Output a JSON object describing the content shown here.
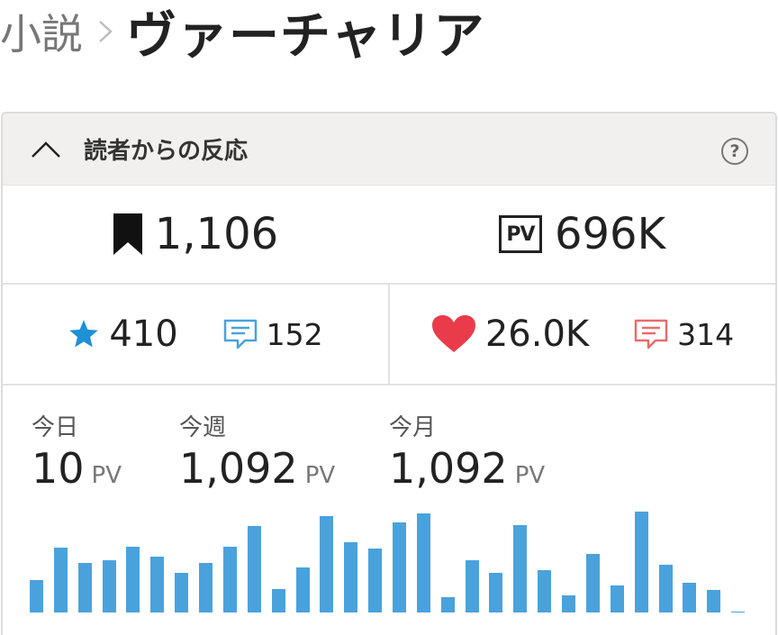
{
  "breadcrumb": {
    "parent": "小説",
    "title": "ヴァーチャリア"
  },
  "panel": {
    "title": "読者からの反応",
    "help": "?"
  },
  "bookmarks": {
    "icon": "bookmark-icon",
    "value": "1,106"
  },
  "pageviews": {
    "icon": "pv-icon",
    "icon_text": "PV",
    "value": "696K"
  },
  "stars": {
    "icon": "star-icon",
    "value": "410",
    "color": "#1e90d6"
  },
  "star_comments": {
    "icon": "comment-icon",
    "value": "152",
    "color": "#4aa2dc"
  },
  "likes": {
    "icon": "heart-icon",
    "value": "26.0K",
    "color": "#ea3b4a"
  },
  "like_comments": {
    "icon": "comment-icon",
    "value": "314",
    "color": "#ea6b6b"
  },
  "stats": {
    "today": {
      "label": "今日",
      "value": "10",
      "unit": "PV"
    },
    "week": {
      "label": "今週",
      "value": "1,092",
      "unit": "PV"
    },
    "month": {
      "label": "今月",
      "value": "1,092",
      "unit": "PV"
    }
  },
  "chart_data": {
    "type": "bar",
    "bar_color": "#4aa2dc",
    "values": [
      36,
      71,
      55,
      57,
      72,
      61,
      44,
      55,
      72,
      95,
      26,
      50,
      106,
      77,
      70,
      99,
      109,
      17,
      57,
      44,
      96,
      47,
      19,
      64,
      30,
      111,
      53,
      33,
      25,
      1
    ]
  }
}
